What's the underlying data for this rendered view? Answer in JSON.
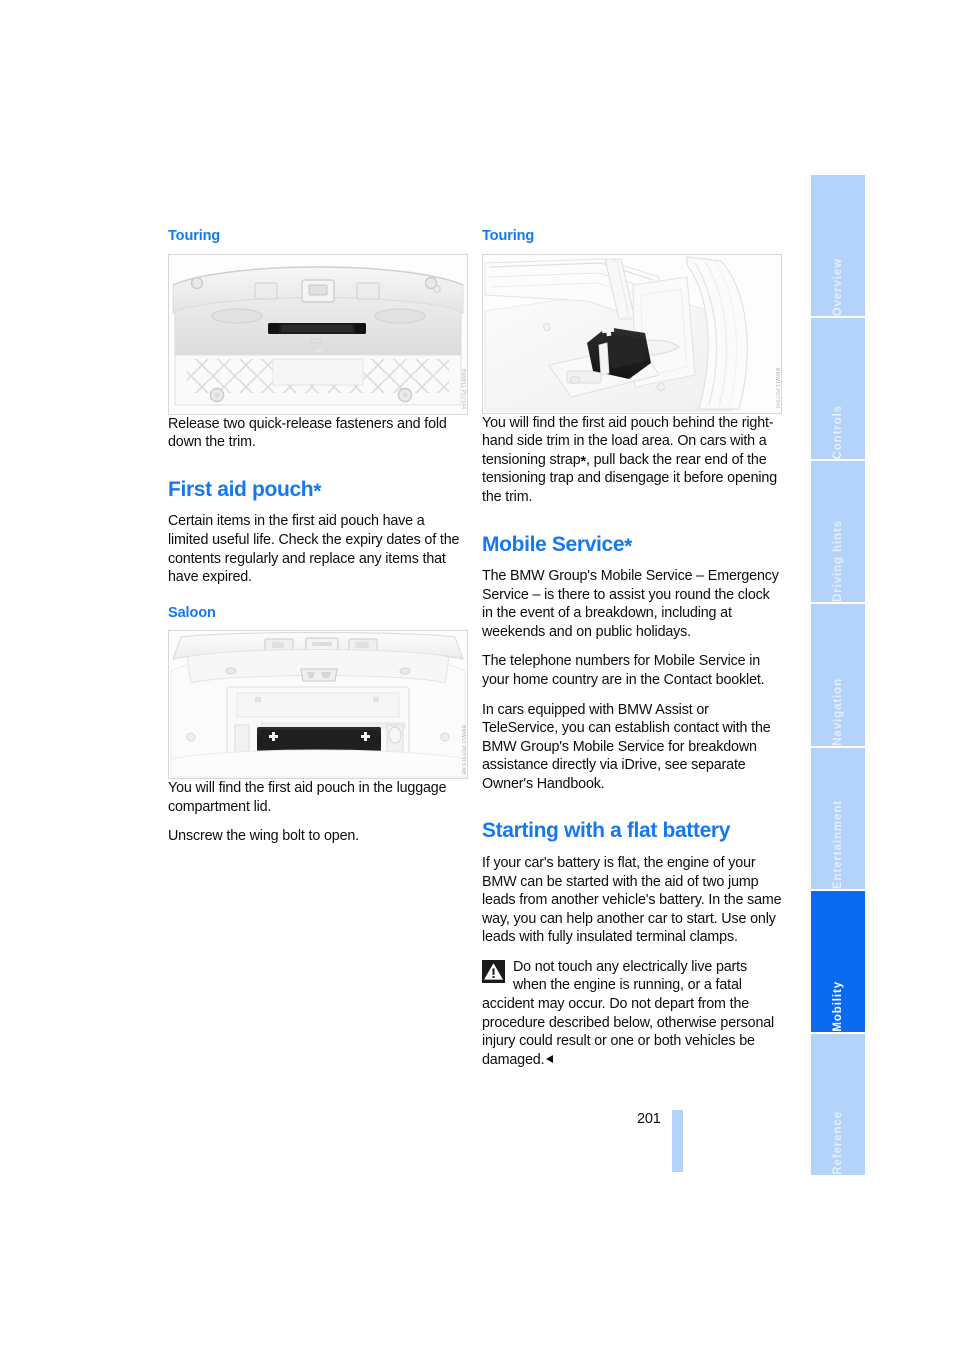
{
  "page": {
    "number": "201"
  },
  "left_column": {
    "touring_heading": "Touring",
    "touring_caption": "Release two quick-release fasteners and fold down the trim.",
    "first_aid_title": "First aid pouch*",
    "first_aid_intro": "Certain items in the first aid pouch have a limited useful life. Check the expiry dates of the contents regularly and replace any items that have expired.",
    "saloon_heading": "Saloon",
    "saloon_caption_1": "You will find the first aid pouch in the luggage compartment lid.",
    "saloon_caption_2": "Unscrew the wing bolt to open."
  },
  "right_column": {
    "touring_heading": "Touring",
    "touring_caption": "You will find the first aid pouch behind the right-hand side trim in the load area. On cars with a tensioning strap*, pull back the rear end of the tensioning trap and disengage it before opening the trim.",
    "mobile_service_title": "Mobile Service*",
    "mobile_service_p1": "The BMW Group's Mobile Service – Emergency Service – is there to assist you round the clock in the event of a breakdown, including at weekends and on public holidays.",
    "mobile_service_p2": "The telephone numbers for Mobile Service in your home country are in the Contact booklet.",
    "mobile_service_p3": "In cars equipped with BMW Assist or TeleService, you can establish contact with the BMW Group's Mobile Service for breakdown assistance directly via iDrive, see separate Owner's Handbook.",
    "flat_battery_title": "Starting with a flat battery",
    "flat_battery_p1": "If your car's battery is flat, the engine of your BMW can be started with the aid of two jump leads from another vehicle's battery. In the same way, you can help another car to start. Use only leads with fully insulated terminal clamps.",
    "warning_text": "Do not touch any electrically live parts when the engine is running, or a fatal accident may occur. Do not depart from the procedure described below, otherwise personal injury could result or one or both vehicles be damaged."
  },
  "figures": {
    "touring_left_watermark": "BMW11 PD7344",
    "touring_right_watermark": "BMW11 PD7345",
    "saloon_watermark": "BMW11 PD7313-AB"
  },
  "sidebar": {
    "tabs": [
      {
        "label": "Overview",
        "active": false
      },
      {
        "label": "Controls",
        "active": false
      },
      {
        "label": "Driving hints",
        "active": false
      },
      {
        "label": "Navigation",
        "active": false
      },
      {
        "label": "Entertainment",
        "active": false
      },
      {
        "label": "Mobility",
        "active": true
      },
      {
        "label": "Reference",
        "active": false
      }
    ]
  },
  "colors": {
    "accent_blue": "#1478f0",
    "tab_inactive": "#b4d3fb",
    "tab_active": "#0a6bf0",
    "page_bar": "#b4d3fb",
    "body_text": "#0d0d0d"
  }
}
